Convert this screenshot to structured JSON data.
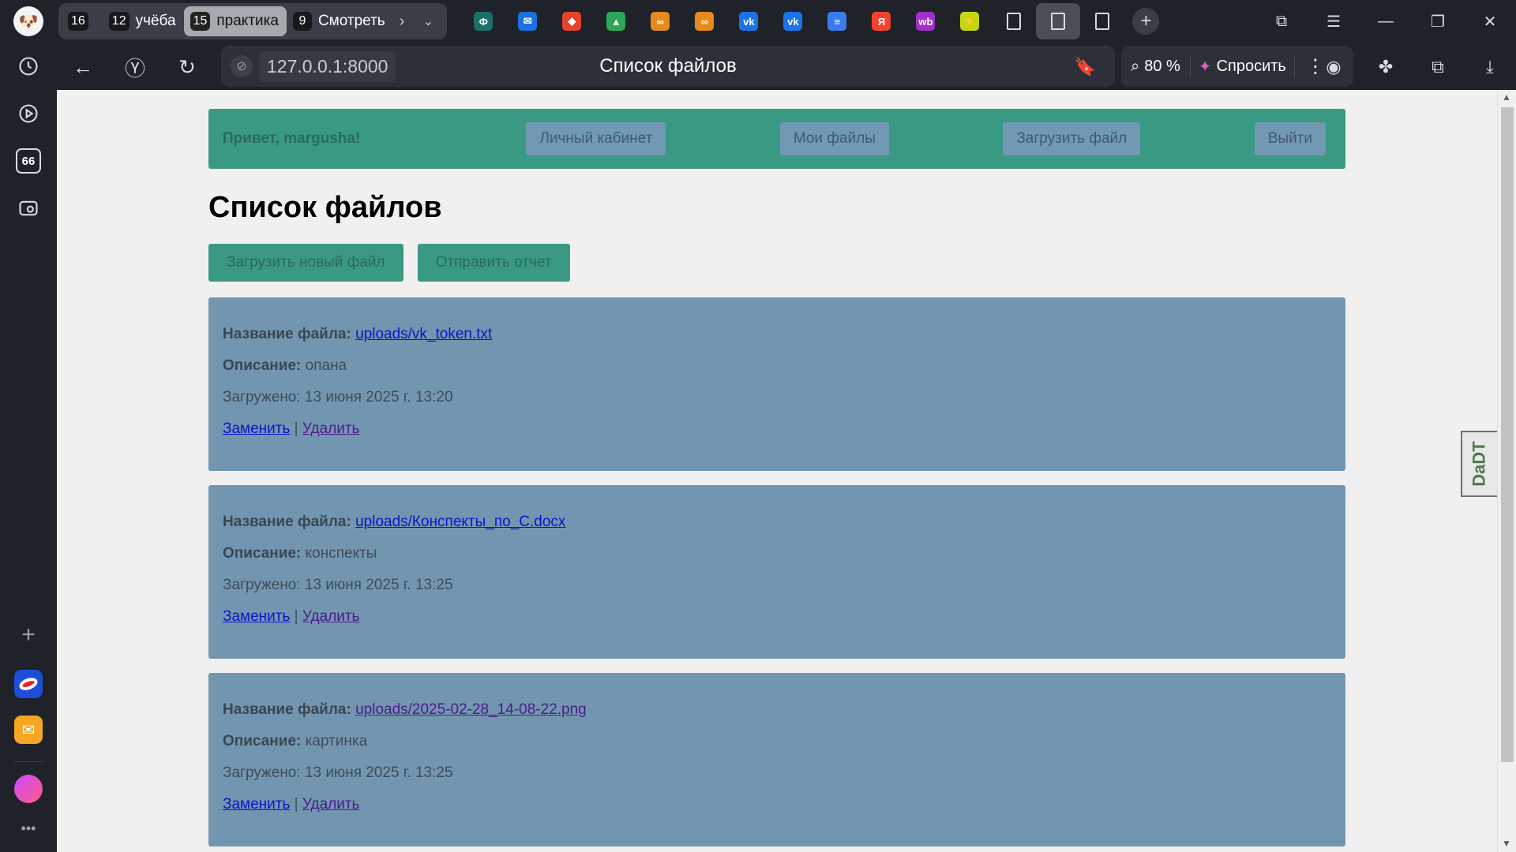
{
  "sidebar": {
    "items": [
      {
        "name": "history-icon"
      },
      {
        "name": "play-icon"
      },
      {
        "name": "badge-66",
        "label": "66"
      },
      {
        "name": "screenshot-icon"
      }
    ],
    "add_label": "+",
    "more_label": "•••"
  },
  "tabs": {
    "groups": [
      {
        "count": "16",
        "label": ""
      },
      {
        "count": "12",
        "label": "учёба"
      },
      {
        "count": "15",
        "label": "практика",
        "active": true
      },
      {
        "count": "9",
        "label": "Смотреть"
      }
    ],
    "favicons": [
      {
        "name": "f-icon",
        "text": "Ф",
        "color": "#1b6e6a"
      },
      {
        "name": "mail-icon",
        "text": "✉",
        "color": "#1e6fe0"
      },
      {
        "name": "gitlab-icon",
        "text": "◆",
        "color": "#e2432a"
      },
      {
        "name": "drive-icon",
        "text": "▲",
        "color": "#2aa855"
      },
      {
        "name": "infinity-icon",
        "text": "∞",
        "color": "#e58a1c"
      },
      {
        "name": "infinity-icon-2",
        "text": "∞",
        "color": "#e58a1c"
      },
      {
        "name": "vk-icon",
        "text": "vk",
        "color": "#1a73e8"
      },
      {
        "name": "vk-icon-2",
        "text": "vk",
        "color": "#1a73e8"
      },
      {
        "name": "docs-icon",
        "text": "≡",
        "color": "#3a7bef"
      },
      {
        "name": "yandex-icon",
        "text": "Я",
        "color": "#f2432f"
      },
      {
        "name": "wb-icon",
        "text": "wb",
        "color": "#a12fc9"
      },
      {
        "name": "striped-icon",
        "text": "⚡",
        "color": "#c7d612"
      },
      {
        "name": "page-icon",
        "text": "",
        "color": "#d8dbe0"
      },
      {
        "name": "page-icon-active",
        "text": "",
        "color": "#d8dbe0",
        "active": true
      },
      {
        "name": "page-icon-2",
        "text": "",
        "color": "#d8dbe0"
      }
    ]
  },
  "address": {
    "url": "127.0.0.1:8000",
    "page_title": "Список файлов",
    "zoom": "80 %",
    "ask_label": "Спросить"
  },
  "page": {
    "greeting": "Привет, margusha!",
    "nav": {
      "profile": "Личный кабинет",
      "my_files": "Мои файлы",
      "upload": "Загрузить файл",
      "logout": "Выйти"
    },
    "heading": "Список файлов",
    "actions": {
      "upload_new": "Загрузить новый файл",
      "send_report": "Отправить отчет"
    },
    "labels": {
      "file_name": "Название файла:",
      "description": "Описание:",
      "replace": "Заменить",
      "delete": "Удалить",
      "separator": "|"
    },
    "files": [
      {
        "name": "uploads/vk_token.txt",
        "description": "опана",
        "uploaded": "Загружено: 13 июня 2025 г. 13:20",
        "visited": false
      },
      {
        "name": "uploads/Конспекты_по_C.docx",
        "description": "конспекты",
        "uploaded": "Загружено: 13 июня 2025 г. 13:25",
        "visited": false
      },
      {
        "name": "uploads/2025-02-28_14-08-22.png",
        "description": "картинка",
        "uploaded": "Загружено: 13 июня 2025 г. 13:25",
        "visited": true
      }
    ]
  },
  "extension_tab": {
    "label": "DaDT"
  }
}
